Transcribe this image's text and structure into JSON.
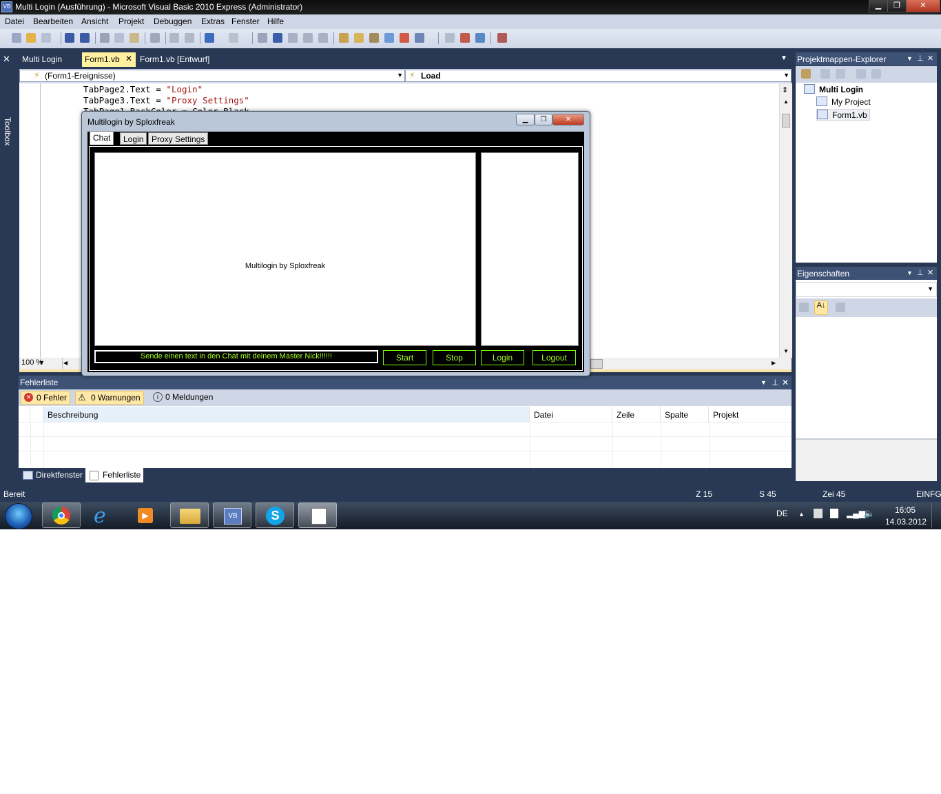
{
  "window": {
    "title": "Multi Login (Ausführung) - Microsoft Visual Basic 2010 Express (Administrator)",
    "app_icon": "VB",
    "minimize": "▁",
    "restore": "❐",
    "close": "✕"
  },
  "menu": [
    "Datei",
    "Bearbeiten",
    "Ansicht",
    "Projekt",
    "Debuggen",
    "Extras",
    "Fenster",
    "Hilfe"
  ],
  "toolbox_label": "Toolbox",
  "doc_tabs": [
    {
      "label": "Multi Login",
      "active": false
    },
    {
      "label": "Form1.vb",
      "active": true
    },
    {
      "label": "Form1.vb [Entwurf]",
      "active": false
    }
  ],
  "editor": {
    "object_dropdown": "(Form1-Ereignisse)",
    "event_dropdown": "Load",
    "code_lines": [
      {
        "prefix": "TabPage2.Text = ",
        "string": "\"Login\"",
        "suffix": ""
      },
      {
        "prefix": "TabPage3.Text = ",
        "string": "\"Proxy Settings\"",
        "suffix": ""
      },
      {
        "prefix": "TabPage1.BackColor = Color.Black",
        "string": "",
        "suffix": ""
      }
    ],
    "zoom": "100 %"
  },
  "running_app": {
    "title": "Multilogin by Sploxfreak",
    "tabs": [
      "Chat",
      "Login",
      "Proxy Settings"
    ],
    "active_tab": "Chat",
    "chat_text": "Multilogin by Sploxfreak",
    "input_text": "Sende einen text in den Chat mit deinem Master Nick!!!!!!",
    "buttons": {
      "start": "Start",
      "stop": "Stop",
      "login": "Login",
      "logout": "Logout"
    },
    "accent_color": "#a8ff20"
  },
  "error_list": {
    "title": "Fehlerliste",
    "errors": "0 Fehler",
    "warnings": "0 Warnungen",
    "messages": "0 Meldungen",
    "columns": [
      "Beschreibung",
      "Datei",
      "Zeile",
      "Spalte",
      "Projekt"
    ]
  },
  "bottom_tabs": [
    "Direktfenster",
    "Fehlerliste"
  ],
  "solution_explorer": {
    "title": "Projektmappen-Explorer",
    "root": "Multi Login",
    "items": [
      "My Project",
      "Form1.vb"
    ]
  },
  "properties": {
    "title": "Eigenschaften"
  },
  "statusbar": {
    "state": "Bereit",
    "line": "Z 15",
    "col": "S 45",
    "char": "Zei 45",
    "mode": "EINFG"
  },
  "taskbar": {
    "apps": [
      "chrome-icon",
      "ie-icon",
      "media-player-icon",
      "explorer-icon",
      "vb-express-icon",
      "skype-icon",
      "form-app-icon"
    ],
    "language": "DE",
    "time": "16:05",
    "date": "14.03.2012"
  }
}
